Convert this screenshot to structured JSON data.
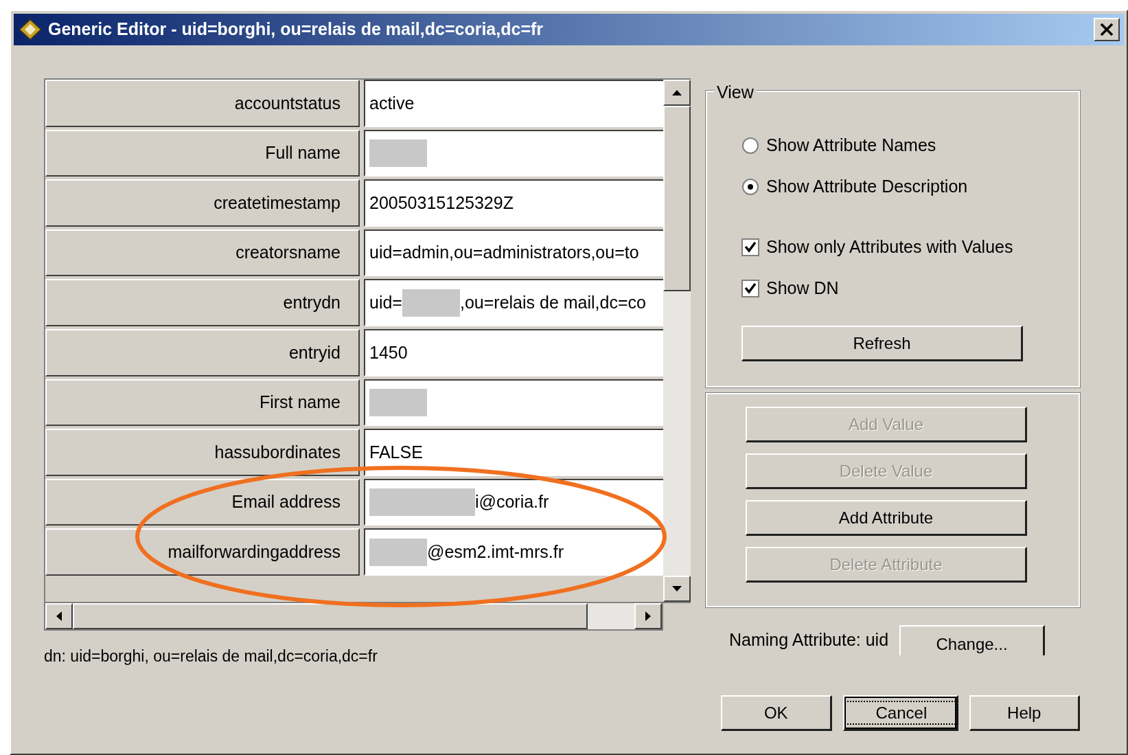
{
  "window": {
    "title": "Generic Editor - uid=borghi, ou=relais de mail,dc=coria,dc=fr"
  },
  "attributes": [
    {
      "label": "accountstatus",
      "value": [
        {
          "kind": "text",
          "text": "active"
        }
      ]
    },
    {
      "label": "Full name",
      "value": [
        {
          "kind": "redaction"
        }
      ]
    },
    {
      "label": "createtimestamp",
      "value": [
        {
          "kind": "text",
          "text": "20050315125329Z"
        }
      ]
    },
    {
      "label": "creatorsname",
      "value": [
        {
          "kind": "text",
          "text": "uid=admin,ou=administrators,ou=to"
        }
      ]
    },
    {
      "label": "entrydn",
      "value": [
        {
          "kind": "text",
          "text": "uid="
        },
        {
          "kind": "redaction"
        },
        {
          "kind": "text",
          "text": ",ou=relais de mail,dc=co"
        }
      ]
    },
    {
      "label": "entryid",
      "value": [
        {
          "kind": "text",
          "text": "1450"
        }
      ]
    },
    {
      "label": "First name",
      "value": [
        {
          "kind": "redaction"
        }
      ]
    },
    {
      "label": "hassubordinates",
      "value": [
        {
          "kind": "text",
          "text": "FALSE"
        }
      ]
    },
    {
      "label": "Email address",
      "value": [
        {
          "kind": "long_redaction"
        },
        {
          "kind": "text",
          "text": "i@coria.fr"
        }
      ]
    },
    {
      "label": "mailforwardingaddress",
      "value": [
        {
          "kind": "redaction"
        },
        {
          "kind": "text",
          "text": "@esm2.imt-mrs.fr"
        }
      ]
    }
  ],
  "dn": "dn: uid=borghi, ou=relais de mail,dc=coria,dc=fr",
  "view": {
    "title": "View",
    "options": [
      {
        "kind": "radio",
        "label": "Show Attribute Names",
        "selected": false
      },
      {
        "kind": "radio",
        "label": "Show Attribute Description",
        "selected": true
      },
      {
        "kind": "checkbox",
        "label": "Show only Attributes with Values",
        "checked": true
      },
      {
        "kind": "checkbox",
        "label": "Show DN",
        "checked": true
      }
    ],
    "refresh_button": "Refresh"
  },
  "actions": [
    {
      "label": "Add Value",
      "disabled": true
    },
    {
      "label": "Delete Value",
      "disabled": true
    },
    {
      "label": "Add Attribute",
      "disabled": false
    },
    {
      "label": "Delete Attribute",
      "disabled": true
    }
  ],
  "naming": {
    "label": "Naming Attribute: uid",
    "button": "Change..."
  },
  "buttons": [
    {
      "label": "OK",
      "focused": false
    },
    {
      "label": "Cancel",
      "focused": true
    },
    {
      "label": "Help",
      "focused": false
    }
  ],
  "annotation": {
    "kind": "ellipse",
    "color": "#f07020"
  }
}
